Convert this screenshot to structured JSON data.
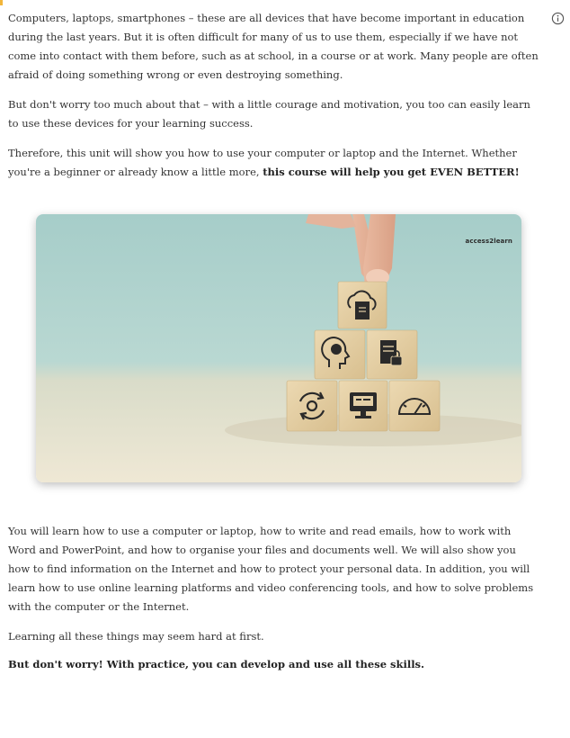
{
  "content": {
    "intro_paragraph_1": "Computers, laptops, smartphones – these are all devices that have become important in education during the last years. But it is often difficult for many of us to use them, especially if we have not come into contact with them before, such as at school, in a course or at work. Many people are often afraid of doing something wrong or even destroying something.",
    "intro_paragraph_2": "But don't worry too much about that – with a little courage and motivation, you too can easily learn to use these devices for your learning success.",
    "intro_paragraph_3_start": "Therefore, this unit will show you how to use your computer or laptop and the Internet. Whether you're a beginner or already know a little more, ",
    "intro_paragraph_3_bold": "this course will help you get EVEN BETTER!",
    "image_brand": "access2learn",
    "body_paragraph_1": "You will learn how to use a computer or laptop, how to write and read emails, how to work with Word and PowerPoint, and how to organise your files and documents well. We will also show you how to find information on the Internet and how to protect your personal data. In addition, you will learn how to use online learning platforms and video conferencing tools, and how to solve problems with the computer or the Internet.",
    "body_paragraph_2": "Learning all these things may seem hard at first.",
    "closing_bold": "But don't worry! With practice, you can develop and use all these skills."
  },
  "icons": {
    "info": "info-circle-icon",
    "cube_top": "cloud-document-icon",
    "cube_mid_left": "head-gear-icon",
    "cube_mid_right": "locked-document-icon",
    "cube_bottom_left": "sync-gear-icon",
    "cube_bottom_center": "monitor-icon",
    "cube_bottom_right": "speedometer-icon"
  },
  "colors": {
    "accent": "#f2b63b",
    "text": "#333333",
    "image_background": "#a9cfcb",
    "table_surface": "#e9e2cf",
    "wood_cube": "#e3cfa6"
  }
}
